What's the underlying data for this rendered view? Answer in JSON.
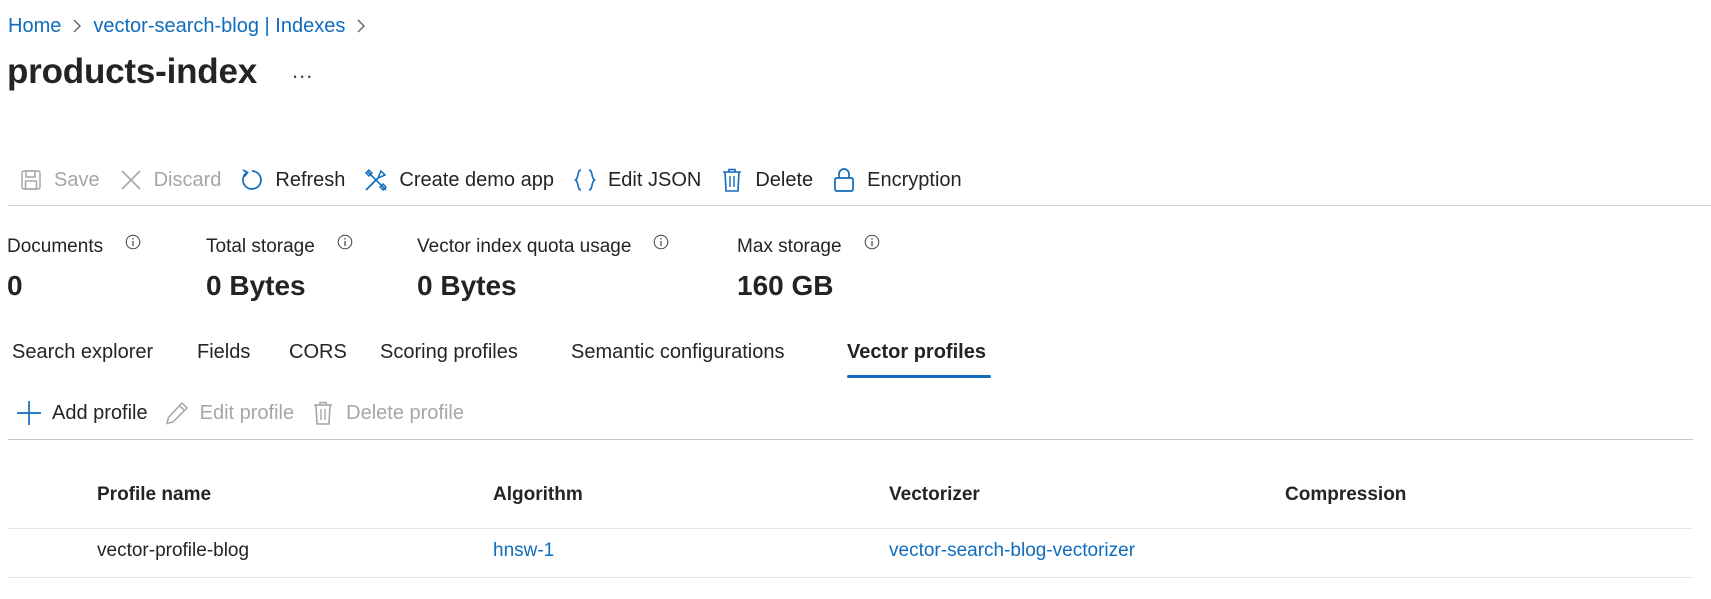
{
  "breadcrumb": [
    {
      "label": "Home"
    },
    {
      "label": "vector-search-blog | Indexes"
    }
  ],
  "page": {
    "title": "products-index",
    "more_label": "..."
  },
  "toolbar": {
    "save": "Save",
    "discard": "Discard",
    "refresh": "Refresh",
    "create_demo_app": "Create demo app",
    "edit_json": "Edit JSON",
    "delete": "Delete",
    "encryption": "Encryption"
  },
  "stats": [
    {
      "label": "Documents",
      "value": "0"
    },
    {
      "label": "Total storage",
      "value": "0 Bytes"
    },
    {
      "label": "Vector index quota usage",
      "value": "0 Bytes"
    },
    {
      "label": "Max storage",
      "value": "160 GB"
    }
  ],
  "tabs": [
    {
      "label": "Search explorer",
      "active": false
    },
    {
      "label": "Fields",
      "active": false
    },
    {
      "label": "CORS",
      "active": false
    },
    {
      "label": "Scoring profiles",
      "active": false
    },
    {
      "label": "Semantic configurations",
      "active": false
    },
    {
      "label": "Vector profiles",
      "active": true
    }
  ],
  "profile_toolbar": {
    "add": "Add profile",
    "edit": "Edit profile",
    "delete": "Delete profile"
  },
  "table": {
    "columns": [
      "Profile name",
      "Algorithm",
      "Vectorizer",
      "Compression"
    ],
    "rows": [
      {
        "profile_name": "vector-profile-blog",
        "algorithm": "hnsw-1",
        "vectorizer": "vector-search-blog-vectorizer",
        "compression": ""
      }
    ]
  },
  "colors": {
    "accent": "#0f6cbd",
    "disabled": "#a6a6a6",
    "text": "#242424"
  }
}
